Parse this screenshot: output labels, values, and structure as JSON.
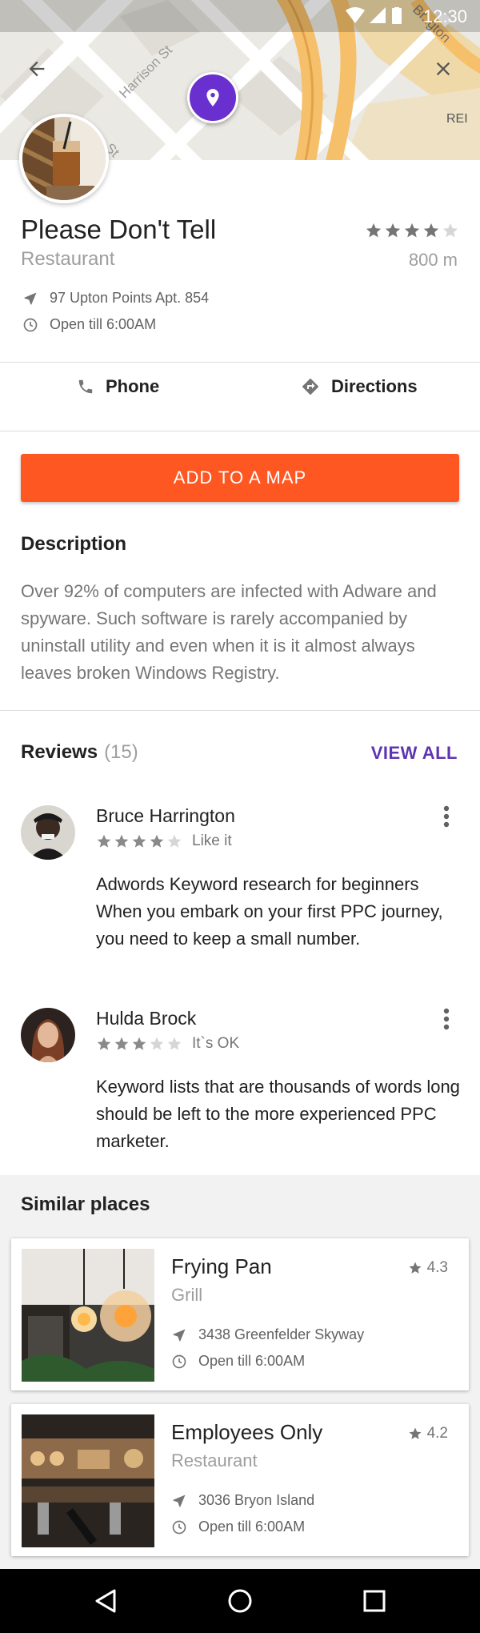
{
  "status_bar": {
    "time": "12:30"
  },
  "map": {
    "street_labels": [
      "Harrison St",
      "Br..gton",
      "St"
    ],
    "poi_label": "REI"
  },
  "place": {
    "title": "Please Don't Tell",
    "type": "Restaurant",
    "rating": 4,
    "rating_max": 5,
    "distance": "800 m",
    "address": "97 Upton Points Apt. 854",
    "hours": "Open till 6:00AM"
  },
  "actions": {
    "phone_label": "Phone",
    "directions_label": "Directions"
  },
  "cta_label": "ADD TO A MAP",
  "description": {
    "title": "Description",
    "text": "Over 92% of computers are infected with Adware and spyware. Such software is rarely accompanied by uninstall utility and even when it is it almost always leaves broken Windows Registry."
  },
  "reviews": {
    "title": "Reviews",
    "count": "(15)",
    "view_all_label": "VIEW ALL",
    "items": [
      {
        "name": "Bruce Harrington",
        "rating": 4,
        "mood": "Like it",
        "text": "Adwords Keyword research for beginners When you embark on your first PPC journey, you need to keep a small number."
      },
      {
        "name": "Hulda Brock",
        "rating": 3,
        "mood": "It`s OK",
        "text": "Keyword lists that are thousands of words long should be left to the more experienced PPC marketer."
      }
    ]
  },
  "similar": {
    "title": "Similar places",
    "items": [
      {
        "name": "Frying Pan",
        "type": "Grill",
        "rating": "4.3",
        "address": "3438 Greenfelder Skyway",
        "hours": "Open till 6:00AM"
      },
      {
        "name": "Employees Only",
        "type": "Restaurant",
        "rating": "4.2",
        "address": "3036 Bryon Island",
        "hours": "Open till 6:00AM"
      }
    ]
  },
  "colors": {
    "accent": "#ff5722",
    "link": "#5e35b1",
    "pin": "#6a2fcf"
  }
}
